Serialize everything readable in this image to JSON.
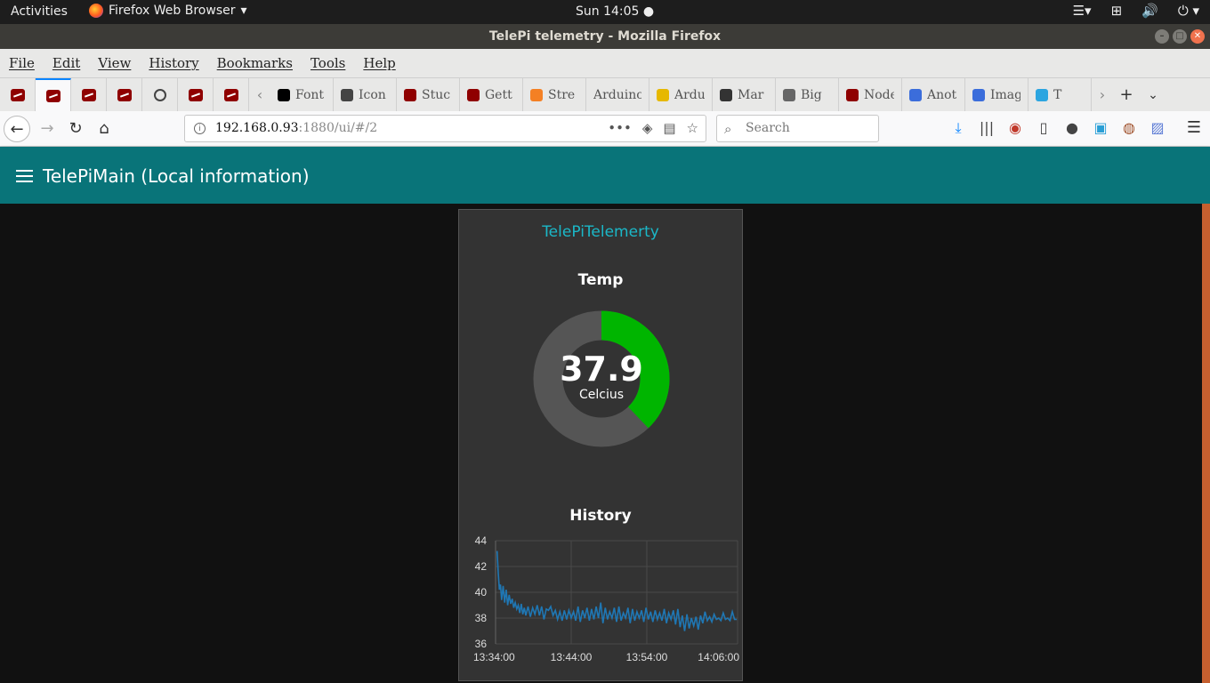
{
  "system": {
    "activities": "Activities",
    "app_name": "Firefox Web Browser",
    "clock": "Sun 14:05"
  },
  "window": {
    "title": "TelePi telemetry - Mozilla Firefox"
  },
  "menubar": [
    "File",
    "Edit",
    "View",
    "History",
    "Bookmarks",
    "Tools",
    "Help"
  ],
  "tabs": [
    {
      "label": "Font",
      "icon": "flag-icon",
      "color": "#000000"
    },
    {
      "label": "Icon",
      "icon": "bootstrap-icon",
      "color": "#444444"
    },
    {
      "label": "Stuc",
      "icon": "nodered-icon",
      "color": "#8f0000"
    },
    {
      "label": "Gett",
      "icon": "nodered-icon",
      "color": "#8f0000"
    },
    {
      "label": "Stre",
      "icon": "stackoverflow-icon",
      "color": "#f48024"
    },
    {
      "label": "Arduino",
      "icon": "none",
      "color": ""
    },
    {
      "label": "Ardu",
      "icon": "arduino-icon",
      "color": "#e6b800"
    },
    {
      "label": "Mar",
      "icon": "markdown-icon",
      "color": "#333333"
    },
    {
      "label": "Big",
      "icon": "avatar-icon",
      "color": "#666666"
    },
    {
      "label": "Node",
      "icon": "nodered-icon",
      "color": "#8f0000"
    },
    {
      "label": "Anot",
      "icon": "chat-icon",
      "color": "#3b6ddb"
    },
    {
      "label": "Imag",
      "icon": "chat-icon",
      "color": "#3b6ddb"
    },
    {
      "label": "T",
      "icon": "telegram-icon",
      "color": "#2ca5e0"
    }
  ],
  "navbar": {
    "url_host": "192.168.0.93",
    "url_path": ":1880/ui/#/2",
    "search_placeholder": "Search"
  },
  "dashboard": {
    "header_title": "TelePiMain (Local information)",
    "group_title": "TelePiTelemerty",
    "gauge": {
      "label": "Temp",
      "value": "37.9",
      "units": "Celcius",
      "numeric_value": 37.9,
      "min": 0,
      "max": 100,
      "fill_color": "#00b500",
      "track_color": "#555555"
    },
    "chart_label": "History"
  },
  "chart_data": {
    "type": "line",
    "title": "History",
    "xlabel": "",
    "ylabel": "",
    "ylim": [
      36,
      44
    ],
    "y_ticks": [
      "36",
      "38",
      "40",
      "42",
      "44"
    ],
    "x_ticks": [
      "13:34:00",
      "13:44:00",
      "13:54:00",
      "14:06:00"
    ],
    "x_tick_minutes": [
      0,
      10,
      20,
      32
    ],
    "xlim_minutes": [
      0,
      32
    ],
    "grid": true,
    "series": [
      {
        "color": "#1f77b4",
        "x_minutes": [
          0.2,
          0.35,
          0.5,
          0.65,
          0.8,
          1.0,
          1.2,
          1.4,
          1.6,
          1.8,
          2.0,
          2.2,
          2.4,
          2.6,
          2.8,
          3.0,
          3.2,
          3.4,
          3.6,
          3.8,
          4.0,
          4.3,
          4.6,
          4.9,
          5.2,
          5.5,
          5.8,
          6.1,
          6.4,
          6.7,
          7.0,
          7.3,
          7.6,
          7.9,
          8.2,
          8.5,
          8.8,
          9.1,
          9.4,
          9.7,
          10.0,
          10.3,
          10.6,
          10.9,
          11.2,
          11.5,
          11.8,
          12.1,
          12.4,
          12.7,
          13.0,
          13.3,
          13.6,
          13.9,
          14.2,
          14.5,
          14.8,
          15.1,
          15.4,
          15.7,
          16.0,
          16.3,
          16.6,
          16.9,
          17.2,
          17.5,
          17.8,
          18.1,
          18.4,
          18.7,
          19.0,
          19.3,
          19.6,
          19.9,
          20.2,
          20.5,
          20.8,
          21.1,
          21.4,
          21.7,
          22.0,
          22.3,
          22.6,
          22.9,
          23.2,
          23.5,
          23.8,
          24.1,
          24.4,
          24.7,
          25.0,
          25.3,
          25.6,
          25.9,
          26.2,
          26.5,
          26.8,
          27.1,
          27.4,
          27.7,
          28.0,
          28.3,
          28.6,
          28.9,
          29.2,
          29.5,
          29.8,
          30.1,
          30.4,
          30.7,
          31.0,
          31.3,
          31.6,
          31.9
        ],
        "y": [
          43.2,
          41.5,
          40.2,
          40.6,
          39.4,
          40.5,
          39.2,
          40.2,
          39.0,
          39.8,
          39.1,
          39.5,
          38.8,
          39.2,
          38.7,
          39.0,
          38.4,
          39.1,
          38.3,
          38.8,
          38.2,
          38.9,
          38.1,
          38.8,
          38.3,
          39.0,
          38.2,
          38.9,
          37.9,
          38.7,
          38.6,
          38.9,
          38.2,
          38.6,
          37.9,
          38.5,
          37.8,
          38.6,
          37.9,
          38.6,
          38.0,
          38.5,
          37.8,
          38.9,
          37.7,
          38.6,
          38.0,
          38.8,
          37.8,
          38.7,
          37.9,
          38.9,
          38.0,
          39.2,
          37.6,
          38.8,
          37.9,
          38.5,
          38.0,
          38.8,
          37.7,
          38.9,
          37.8,
          38.4,
          38.0,
          38.8,
          37.6,
          38.7,
          37.8,
          38.5,
          38.0,
          38.6,
          37.7,
          38.8,
          37.9,
          38.5,
          37.7,
          38.6,
          37.9,
          38.4,
          37.8,
          38.7,
          37.6,
          38.4,
          37.9,
          38.6,
          37.5,
          38.7,
          37.3,
          38.2,
          37.0,
          38.3,
          37.2,
          38.0,
          37.4,
          38.1,
          37.1,
          38.2,
          37.6,
          38.5,
          37.8,
          38.1,
          37.7,
          38.3,
          37.9,
          38.0,
          37.8,
          38.4,
          37.9,
          38.0,
          37.8,
          38.5,
          37.9,
          37.9
        ]
      }
    ]
  }
}
